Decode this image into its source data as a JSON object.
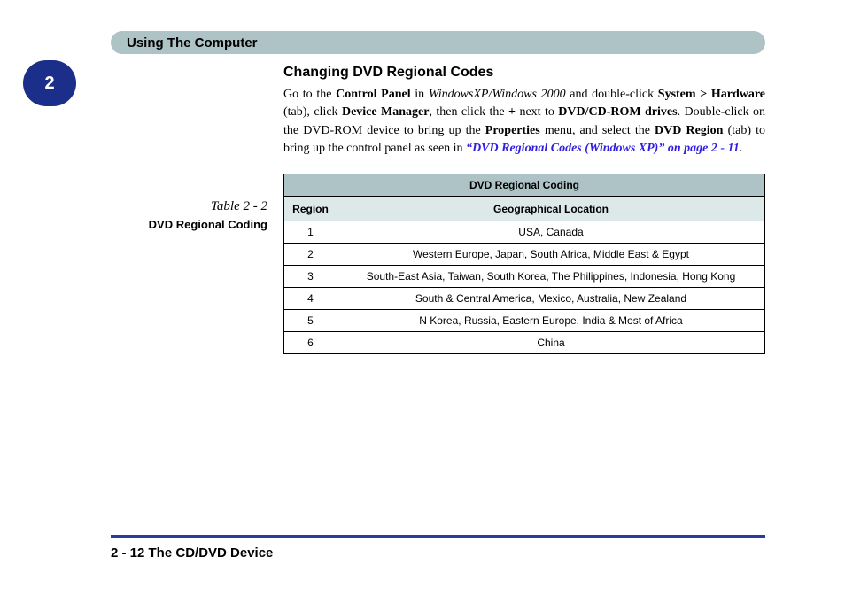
{
  "header": {
    "title": "Using The Computer"
  },
  "chapter": {
    "number": "2"
  },
  "section": {
    "heading": "Changing DVD Regional Codes",
    "paragraph": {
      "t1": "Go to the ",
      "b1": "Control Panel",
      "t2": " in ",
      "i1": "WindowsXP/Windows 2000",
      "t3": " and double-click ",
      "b2": "System > Hardware",
      "t4": " (tab), click ",
      "b3": "Device Manager",
      "t5": ", then click the ",
      "b4": "+",
      "t6": " next to ",
      "b5": "DVD/CD-ROM drives",
      "t7": ". Double-click on the DVD-ROM device to bring up the ",
      "b6": "Properties",
      "t8": " menu, and select the ",
      "b7": "DVD Region",
      "t9": " (tab) to bring up the control panel as seen in ",
      "ref": "“DVD Regional Codes (Windows XP)” on page 2 - 11",
      "t10": "."
    }
  },
  "caption": {
    "number": "Table 2 - 2",
    "title": "DVD Regional Coding"
  },
  "table": {
    "top_header": "DVD Regional Coding",
    "col_region": "Region",
    "col_location": "Geographical Location",
    "rows": [
      {
        "region": "1",
        "location": "USA, Canada"
      },
      {
        "region": "2",
        "location": "Western Europe, Japan, South Africa, Middle East & Egypt"
      },
      {
        "region": "3",
        "location": "South-East Asia, Taiwan, South Korea, The Philippines, Indonesia, Hong Kong"
      },
      {
        "region": "4",
        "location": "South & Central America, Mexico, Australia, New Zealand"
      },
      {
        "region": "5",
        "location": "N Korea, Russia, Eastern Europe, India & Most of Africa"
      },
      {
        "region": "6",
        "location": "China"
      }
    ]
  },
  "footer": {
    "text": "2  -  12  The CD/DVD Device"
  }
}
